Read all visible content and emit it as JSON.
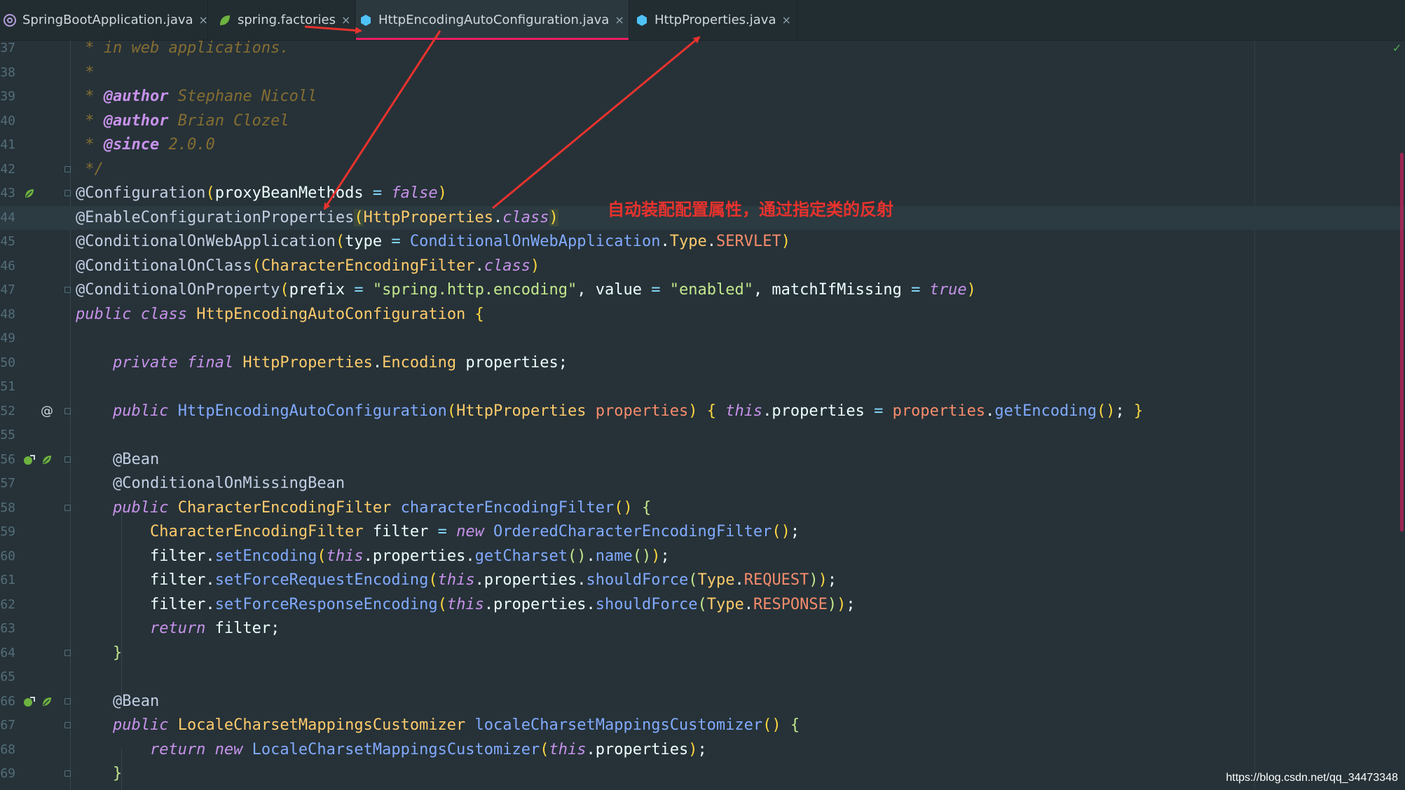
{
  "tabs": [
    {
      "label": "SpringBootApplication.java",
      "icon": "annotation-at-icon",
      "active": false
    },
    {
      "label": "spring.factories",
      "icon": "spring-leaf-icon",
      "active": false
    },
    {
      "label": "HttpEncodingAutoConfiguration.java",
      "icon": "java-class-icon",
      "active": true
    },
    {
      "label": "HttpProperties.java",
      "icon": "java-class-icon",
      "active": false
    }
  ],
  "close_glyph": "×",
  "note": "自动装配配置属性，通过指定类的反射",
  "watermark": "https://blog.csdn.net/qq_34473348",
  "colors": {
    "accent": "#e91e63",
    "arrow": "#e8322d",
    "background": "#263238"
  },
  "lines": [
    {
      "num": "37",
      "tokens": [
        [
          "c-doc",
          " * in web applications."
        ]
      ]
    },
    {
      "num": "38",
      "tokens": [
        [
          "c-doc",
          " *"
        ]
      ]
    },
    {
      "num": "39",
      "tokens": [
        [
          "c-doc",
          " * "
        ],
        [
          "c-doctag",
          "@author"
        ],
        [
          "c-docval",
          " Stephane Nicoll"
        ]
      ]
    },
    {
      "num": "40",
      "tokens": [
        [
          "c-doc",
          " * "
        ],
        [
          "c-doctag",
          "@author"
        ],
        [
          "c-docval",
          " Brian Clozel"
        ]
      ]
    },
    {
      "num": "41",
      "tokens": [
        [
          "c-doc",
          " * "
        ],
        [
          "c-doctag",
          "@since"
        ],
        [
          "c-docval",
          " 2.0.0"
        ]
      ]
    },
    {
      "num": "42",
      "tokens": [
        [
          "c-doc",
          " */"
        ]
      ]
    },
    {
      "num": "43",
      "tokens": [
        [
          "c-ann",
          "@Configuration"
        ],
        [
          "c-br",
          "("
        ],
        [
          "c-pl",
          "proxyBeanMethods "
        ],
        [
          "c-op",
          "="
        ],
        [
          "c-kw",
          " false"
        ],
        [
          "c-br",
          ")"
        ]
      ]
    },
    {
      "num": "44",
      "tokens": [
        [
          "c-ann",
          "@EnableConfigurationProperties"
        ],
        [
          "c-brhl",
          "("
        ],
        [
          "c-cls",
          "HttpProperties"
        ],
        [
          "c-pl",
          "."
        ],
        [
          "c-kw",
          "class"
        ],
        [
          "c-brhl",
          ")"
        ]
      ]
    },
    {
      "num": "45",
      "tokens": [
        [
          "c-ann",
          "@ConditionalOnWebApplication"
        ],
        [
          "c-br",
          "("
        ],
        [
          "c-pl",
          "type "
        ],
        [
          "c-op",
          "="
        ],
        [
          "c-ref",
          " ConditionalOnWebApplication"
        ],
        [
          "c-pl",
          "."
        ],
        [
          "c-cls",
          "Type"
        ],
        [
          "c-pl",
          "."
        ],
        [
          "c-enum",
          "SERVLET"
        ],
        [
          "c-br",
          ")"
        ]
      ]
    },
    {
      "num": "46",
      "tokens": [
        [
          "c-ann",
          "@ConditionalOnClass"
        ],
        [
          "c-br",
          "("
        ],
        [
          "c-cls",
          "CharacterEncodingFilter"
        ],
        [
          "c-pl",
          "."
        ],
        [
          "c-kw",
          "class"
        ],
        [
          "c-br",
          ")"
        ]
      ]
    },
    {
      "num": "47",
      "tokens": [
        [
          "c-ann",
          "@ConditionalOnProperty"
        ],
        [
          "c-br",
          "("
        ],
        [
          "c-pl",
          "prefix "
        ],
        [
          "c-op",
          "="
        ],
        [
          "c-str",
          " \"spring.http.encoding\""
        ],
        [
          "c-pl",
          ", value "
        ],
        [
          "c-op",
          "="
        ],
        [
          "c-str",
          " \"enabled\""
        ],
        [
          "c-pl",
          ", matchIfMissing "
        ],
        [
          "c-op",
          "="
        ],
        [
          "c-kw",
          " true"
        ],
        [
          "c-br",
          ")"
        ]
      ]
    },
    {
      "num": "48",
      "tokens": [
        [
          "c-kw",
          "public class"
        ],
        [
          "c-cls",
          " HttpEncodingAutoConfiguration"
        ],
        [
          "c-br",
          " {"
        ]
      ]
    },
    {
      "num": "49",
      "tokens": []
    },
    {
      "num": "50",
      "tokens": [
        [
          "c-kw",
          "    private final"
        ],
        [
          "c-cls",
          " HttpProperties"
        ],
        [
          "c-pl",
          "."
        ],
        [
          "c-cls",
          "Encoding"
        ],
        [
          "c-pl",
          " properties;"
        ]
      ]
    },
    {
      "num": "51",
      "tokens": []
    },
    {
      "num": "52",
      "tokens": [
        [
          "c-kw",
          "    public"
        ],
        [
          "c-mth",
          " HttpEncodingAutoConfiguration"
        ],
        [
          "c-br",
          "("
        ],
        [
          "c-cls",
          "HttpProperties"
        ],
        [
          "c-prm",
          " properties"
        ],
        [
          "c-br",
          ")"
        ],
        [
          "c-br",
          " {"
        ],
        [
          "c-kw",
          " this"
        ],
        [
          "c-pl",
          ".properties "
        ],
        [
          "c-op",
          "="
        ],
        [
          "c-prm",
          " properties"
        ],
        [
          "c-pl",
          "."
        ],
        [
          "c-mth",
          "getEncoding"
        ],
        [
          "c-br",
          "()"
        ],
        [
          "c-pl",
          "; "
        ],
        [
          "c-br",
          "}"
        ]
      ]
    },
    {
      "num": "55",
      "tokens": []
    },
    {
      "num": "56",
      "tokens": [
        [
          "c-ann",
          "    @Bean"
        ]
      ]
    },
    {
      "num": "57",
      "tokens": [
        [
          "c-ann",
          "    @ConditionalOnMissingBean"
        ]
      ]
    },
    {
      "num": "58",
      "tokens": [
        [
          "c-kw",
          "    public"
        ],
        [
          "c-cls",
          " CharacterEncodingFilter"
        ],
        [
          "c-mth",
          " characterEncodingFilter"
        ],
        [
          "c-br",
          "()"
        ],
        [
          "c-br2",
          " {"
        ]
      ]
    },
    {
      "num": "59",
      "tokens": [
        [
          "c-cls",
          "        CharacterEncodingFilter"
        ],
        [
          "c-pl",
          " filter "
        ],
        [
          "c-op",
          "="
        ],
        [
          "c-kw",
          " new"
        ],
        [
          "c-ref",
          " OrderedCharacterEncodingFilter"
        ],
        [
          "c-br",
          "()"
        ],
        [
          "c-pl",
          ";"
        ]
      ]
    },
    {
      "num": "60",
      "tokens": [
        [
          "c-pl",
          "        filter."
        ],
        [
          "c-mth",
          "setEncoding"
        ],
        [
          "c-br",
          "("
        ],
        [
          "c-kw",
          "this"
        ],
        [
          "c-pl",
          ".properties."
        ],
        [
          "c-mth",
          "getCharset"
        ],
        [
          "c-br2",
          "()"
        ],
        [
          "c-pl",
          "."
        ],
        [
          "c-mth",
          "name"
        ],
        [
          "c-br2",
          "()"
        ],
        [
          "c-br",
          ")"
        ],
        [
          "c-pl",
          ";"
        ]
      ]
    },
    {
      "num": "61",
      "tokens": [
        [
          "c-pl",
          "        filter."
        ],
        [
          "c-mth",
          "setForceRequestEncoding"
        ],
        [
          "c-br",
          "("
        ],
        [
          "c-kw",
          "this"
        ],
        [
          "c-pl",
          ".properties."
        ],
        [
          "c-mth",
          "shouldForce"
        ],
        [
          "c-br2",
          "("
        ],
        [
          "c-cls",
          "Type"
        ],
        [
          "c-pl",
          "."
        ],
        [
          "c-enum",
          "REQUEST"
        ],
        [
          "c-br2",
          ")"
        ],
        [
          "c-br",
          ")"
        ],
        [
          "c-pl",
          ";"
        ]
      ]
    },
    {
      "num": "62",
      "tokens": [
        [
          "c-pl",
          "        filter."
        ],
        [
          "c-mth",
          "setForceResponseEncoding"
        ],
        [
          "c-br",
          "("
        ],
        [
          "c-kw",
          "this"
        ],
        [
          "c-pl",
          ".properties."
        ],
        [
          "c-mth",
          "shouldForce"
        ],
        [
          "c-br2",
          "("
        ],
        [
          "c-cls",
          "Type"
        ],
        [
          "c-pl",
          "."
        ],
        [
          "c-enum",
          "RESPONSE"
        ],
        [
          "c-br2",
          ")"
        ],
        [
          "c-br",
          ")"
        ],
        [
          "c-pl",
          ";"
        ]
      ]
    },
    {
      "num": "63",
      "tokens": [
        [
          "c-kw",
          "        return"
        ],
        [
          "c-pl",
          " filter;"
        ]
      ]
    },
    {
      "num": "64",
      "tokens": [
        [
          "c-br2",
          "    }"
        ]
      ]
    },
    {
      "num": "65",
      "tokens": []
    },
    {
      "num": "66",
      "tokens": [
        [
          "c-ann",
          "    @Bean"
        ]
      ]
    },
    {
      "num": "67",
      "tokens": [
        [
          "c-kw",
          "    public"
        ],
        [
          "c-cls",
          " LocaleCharsetMappingsCustomizer"
        ],
        [
          "c-mth",
          " localeCharsetMappingsCustomizer"
        ],
        [
          "c-br",
          "()"
        ],
        [
          "c-br2",
          " {"
        ]
      ]
    },
    {
      "num": "68",
      "tokens": [
        [
          "c-kw",
          "        return new"
        ],
        [
          "c-ref",
          " LocaleCharsetMappingsCustomizer"
        ],
        [
          "c-br",
          "("
        ],
        [
          "c-kw",
          "this"
        ],
        [
          "c-pl",
          ".properties"
        ],
        [
          "c-br",
          ")"
        ],
        [
          "c-pl",
          ";"
        ]
      ]
    },
    {
      "num": "69",
      "tokens": [
        [
          "c-br2",
          "    }"
        ]
      ]
    }
  ]
}
